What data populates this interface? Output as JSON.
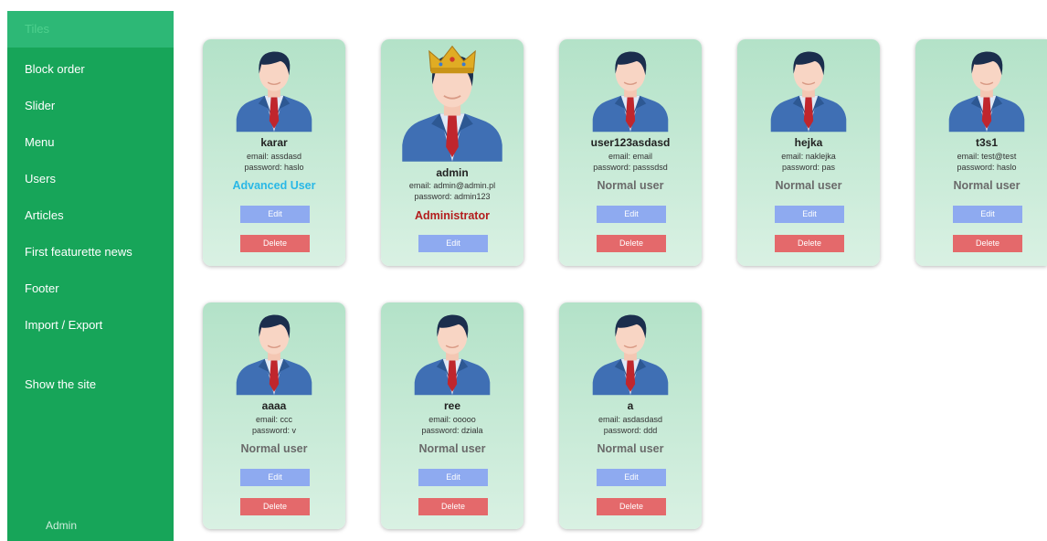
{
  "sidebar": {
    "active_label": "Tiles",
    "items": [
      {
        "label": "Block order"
      },
      {
        "label": "Slider"
      },
      {
        "label": "Menu"
      },
      {
        "label": "Users"
      },
      {
        "label": "Articles"
      },
      {
        "label": "First featurette news"
      },
      {
        "label": "Footer"
      },
      {
        "label": "Import / Export"
      },
      {
        "label": "Show the site"
      }
    ],
    "footer_label": "Admin"
  },
  "users": [
    {
      "name": "karar",
      "email": "email: assdasd",
      "password": "password: haslo",
      "role": "Advanced User",
      "edit_label": "Edit",
      "delete_label": "Delete"
    },
    {
      "name": "admin",
      "email": "email: admin@admin.pl",
      "password": "password: admin123",
      "role": "Administrator",
      "edit_label": "Edit"
    },
    {
      "name": "user123asdasd",
      "email": "email: email",
      "password": "password: passsdsd",
      "role": "Normal user",
      "edit_label": "Edit",
      "delete_label": "Delete"
    },
    {
      "name": "hejka",
      "email": "email: naklejka",
      "password": "password: pas",
      "role": "Normal user",
      "edit_label": "Edit",
      "delete_label": "Delete"
    },
    {
      "name": "t3s1",
      "email": "email: test@test",
      "password": "password: haslo",
      "role": "Normal user",
      "edit_label": "Edit",
      "delete_label": "Delete"
    },
    {
      "name": "aaaa",
      "email": "email: ccc",
      "password": "password: v",
      "role": "Normal user",
      "edit_label": "Edit",
      "delete_label": "Delete"
    },
    {
      "name": "ree",
      "email": "email: ooooo",
      "password": "password: dziala",
      "role": "Normal user",
      "edit_label": "Edit",
      "delete_label": "Delete"
    },
    {
      "name": "a",
      "email": "email: asdasdasd",
      "password": "password: ddd",
      "role": "Normal user",
      "edit_label": "Edit",
      "delete_label": "Delete"
    }
  ],
  "colors": {
    "sidebar_bg": "#17a559",
    "card_bg": "#c6ead6",
    "edit_button": "#8eaaf0",
    "delete_button": "#e4696b",
    "advanced_role": "#2ab8e6",
    "admin_role": "#b31d1d",
    "normal_role": "#6a6a6a"
  },
  "icons": {
    "avatar": "user-avatar-icon",
    "crown": "crown-icon"
  }
}
